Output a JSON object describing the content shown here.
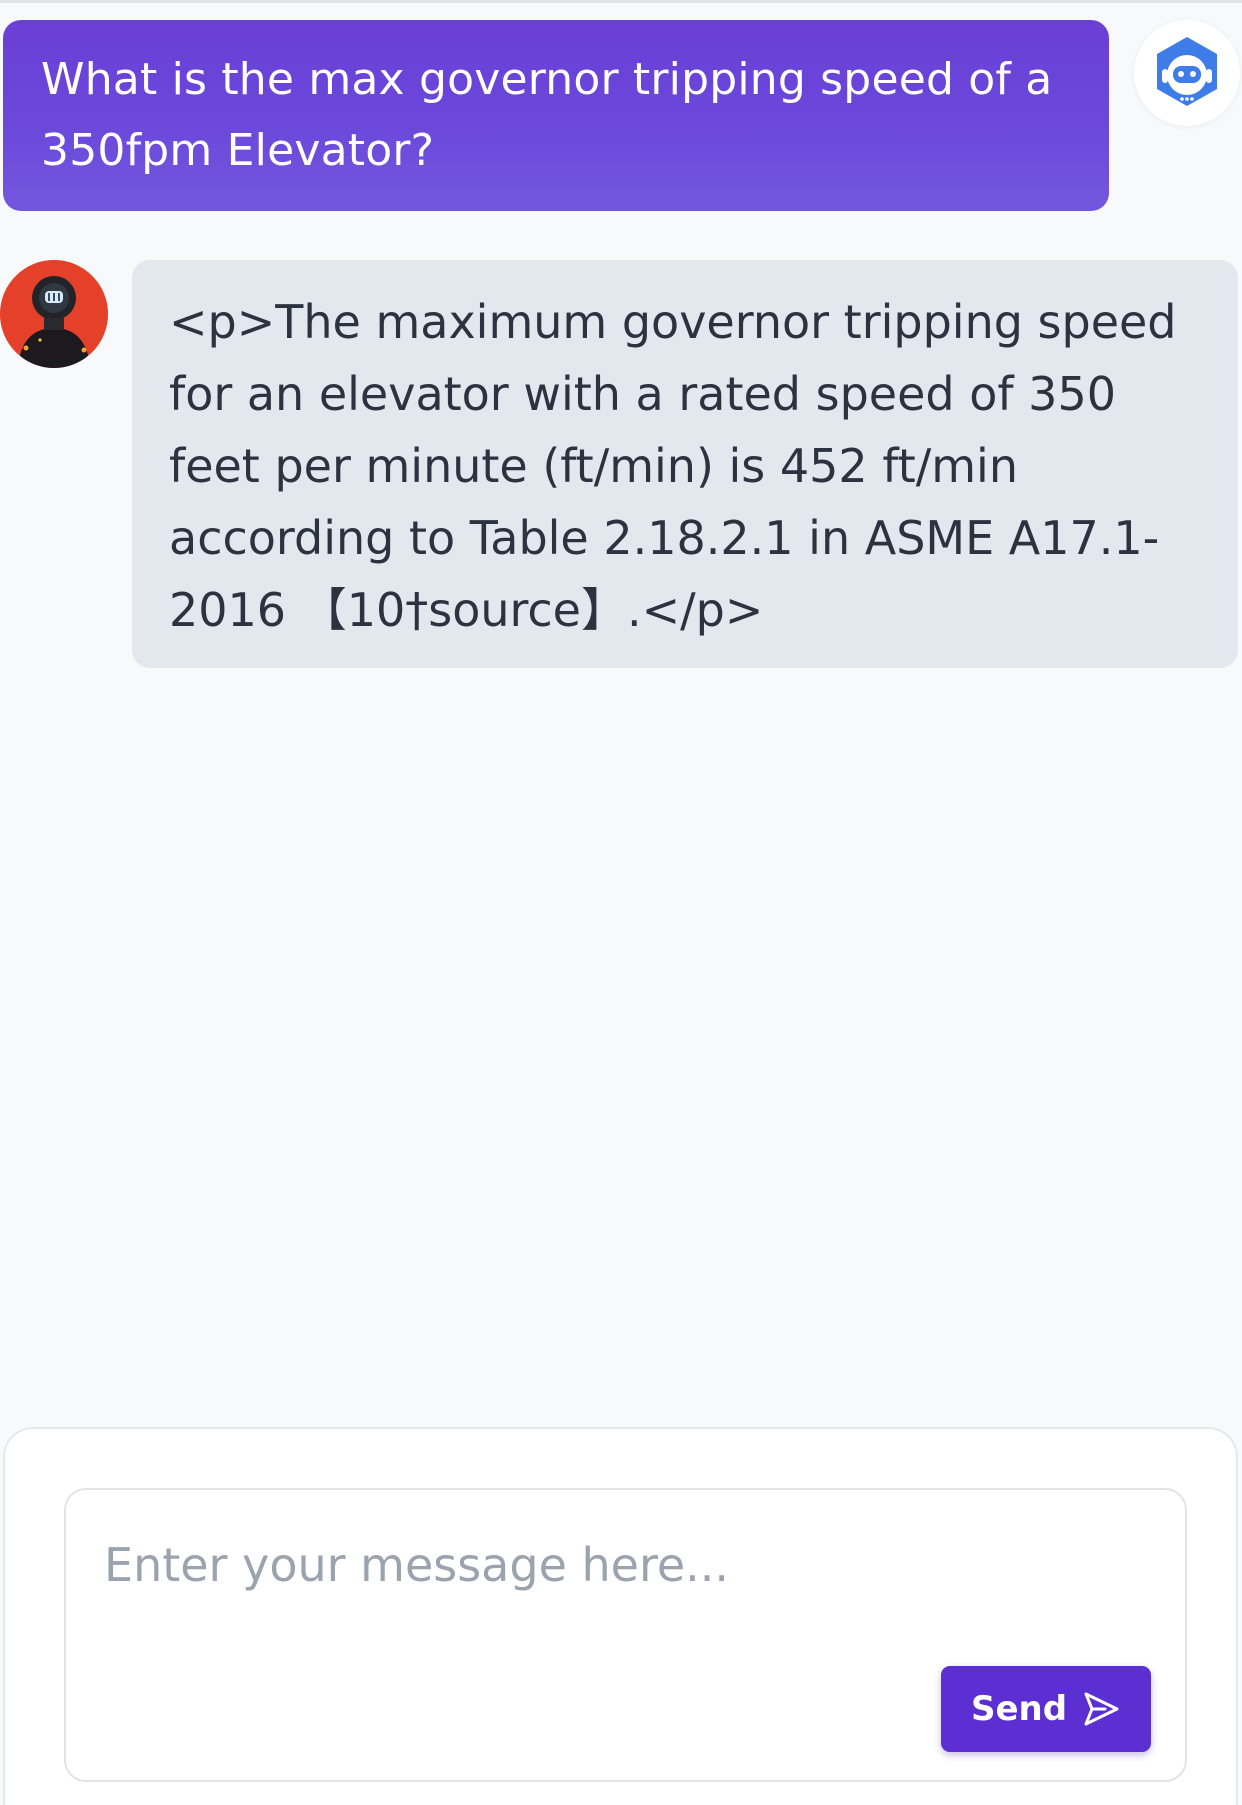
{
  "conversation": {
    "user_message": "What is the max governor tripping speed of a 350fpm Elevator?",
    "bot_reply": "<p>The maximum governor tripping speed for an elevator with a rated speed of 350 feet per minute (ft/min) is 452 ft/min according to Table 2.18.2.1 in ASME A17.1-2016 【10†source】.</p>"
  },
  "composer": {
    "placeholder": "Enter your message here...",
    "send_label": "Send"
  },
  "icons": {
    "bot_badge": "robot-icon",
    "assistant_avatar": "robot-avatar",
    "send": "send-arrow-icon"
  },
  "colors": {
    "accent": "#5b2fd1",
    "user_bubble": "#6b48db",
    "bot_bubble": "#e3e8ef",
    "avatar_bg": "#e5412a"
  }
}
